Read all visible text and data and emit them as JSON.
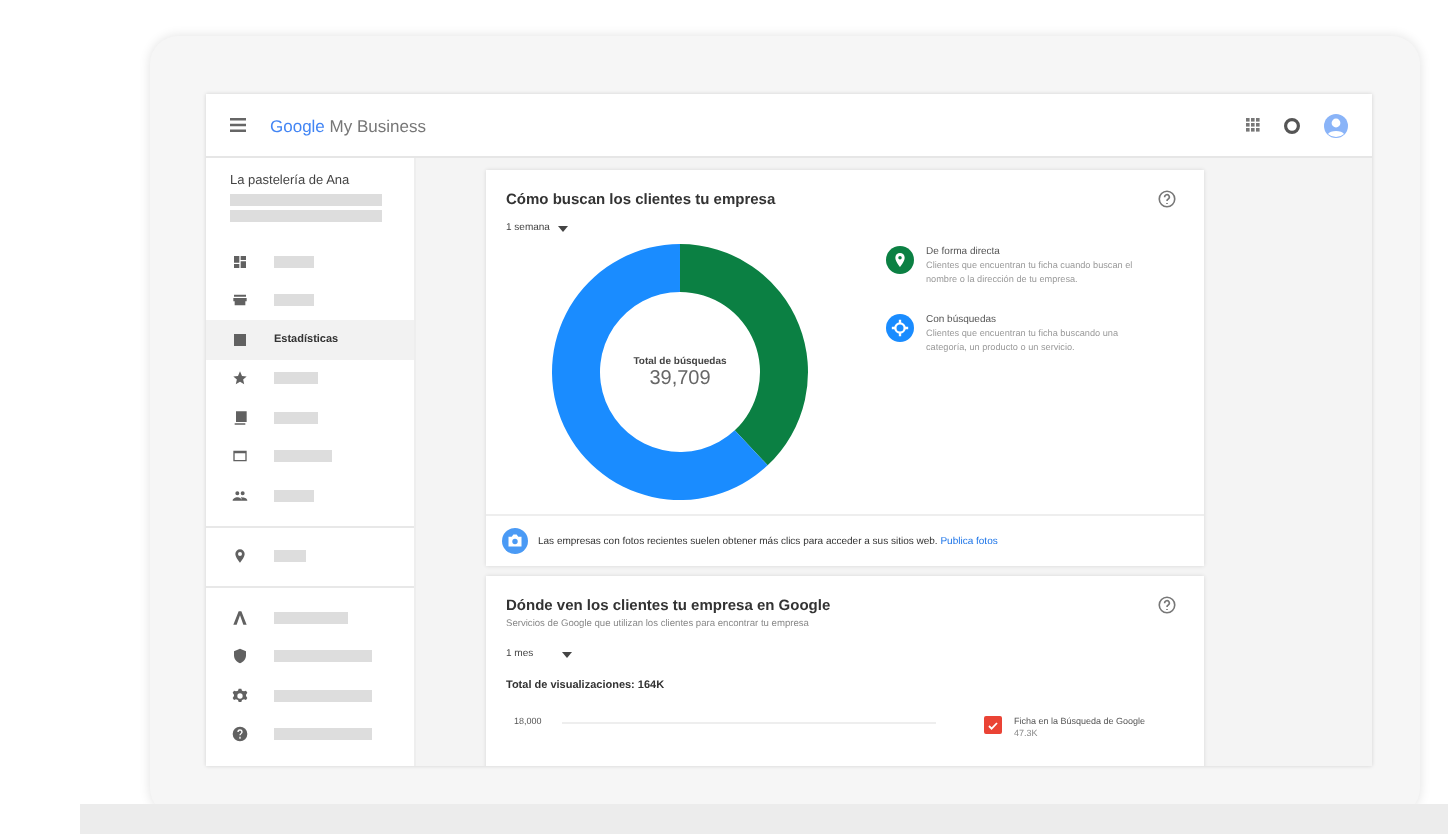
{
  "header": {
    "brand_google": "Google",
    "brand_product": "My Business"
  },
  "sidebar": {
    "business_name": "La pastelería de Ana",
    "sections": [
      [
        {
          "selected": false
        },
        {
          "selected": false
        },
        {
          "selected": true,
          "label": "Estadísticas"
        },
        {
          "selected": false
        },
        {
          "selected": false
        },
        {
          "selected": false
        },
        {
          "selected": false
        }
      ],
      [
        {
          "selected": false
        }
      ],
      [
        {
          "selected": false
        },
        {
          "selected": false
        },
        {
          "selected": false
        },
        {
          "selected": false
        }
      ]
    ]
  },
  "search_card": {
    "title": "Cómo buscan los clientes tu empresa",
    "period": "1 semana",
    "total_label": "Total de búsquedas",
    "total_value": "39,709",
    "legend": [
      {
        "kind": "direct",
        "color": "#0b8043",
        "title": "De forma directa",
        "description": "Clientes que encuentran tu ficha cuando buscan el nombre o la dirección de tu empresa."
      },
      {
        "kind": "discovery",
        "color": "#1a8cff",
        "title": "Con búsquedas",
        "description": "Clientes que encuentran tu ficha buscando una categoría, un producto o un servicio."
      }
    ],
    "tip": "Las empresas con fotos recientes suelen obtener más clics para acceder a sus sitios web.",
    "tip_link": "Publica fotos"
  },
  "views_card": {
    "title": "Dónde ven los clientes tu empresa en Google",
    "subtitle": "Servicios de Google que utilizan los clientes para encontrar tu empresa",
    "period": "1 mes",
    "total": "Total de visualizaciones: 164K",
    "axis_label": "18,000",
    "series": [
      {
        "checked": true,
        "label": "Ficha en la Búsqueda de Google",
        "value": "47.3K"
      }
    ]
  }
}
